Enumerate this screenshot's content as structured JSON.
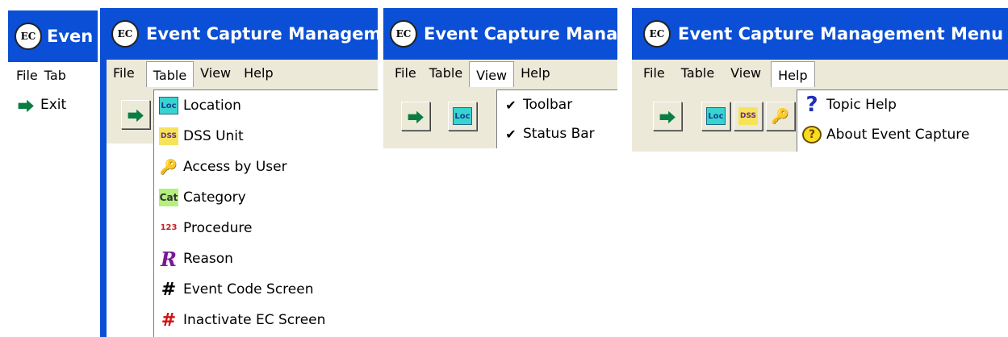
{
  "panels": [
    {
      "title": "Even",
      "menu": [
        "File",
        "Tab"
      ],
      "menu_open": null,
      "dropdown": [
        {
          "label": "Exit",
          "icon": "exit-icon"
        }
      ]
    },
    {
      "title": "Event Capture Managem",
      "menu": [
        "File",
        "Table",
        "View",
        "Help"
      ],
      "menu_open": "Table",
      "dropdown": [
        {
          "label": "Location",
          "icon": "location-icon"
        },
        {
          "label": "DSS Unit",
          "icon": "dss-unit-icon"
        },
        {
          "label": "Access by User",
          "icon": "access-by-user-icon"
        },
        {
          "label": "Category",
          "icon": "category-icon"
        },
        {
          "label": "Procedure",
          "icon": "procedure-icon"
        },
        {
          "label": "Reason",
          "icon": "reason-icon"
        },
        {
          "label": "Event Code Screen",
          "icon": "event-code-grid-icon"
        },
        {
          "label": "Inactivate EC Screen",
          "icon": "inactivate-ec-icon"
        }
      ]
    },
    {
      "title": "Event Capture Mana",
      "menu": [
        "File",
        "Table",
        "View",
        "Help"
      ],
      "menu_open": "View",
      "dropdown": [
        {
          "label": "Toolbar",
          "checked": true
        },
        {
          "label": "Status Bar",
          "checked": true
        }
      ]
    },
    {
      "title": "Event Capture Management Menu",
      "menu": [
        "File",
        "Table",
        "View",
        "Help"
      ],
      "menu_open": "Help",
      "dropdown": [
        {
          "label": "Topic Help",
          "icon": "help-question-icon"
        },
        {
          "label": "About Event Capture",
          "icon": "about-icon"
        }
      ]
    }
  ],
  "icon_glyphs": {
    "app": "EC",
    "loc": "Loc",
    "dss": "DSS",
    "cat": "Cat",
    "proc": "123",
    "reason": "R",
    "grid": "#",
    "help": "?"
  }
}
